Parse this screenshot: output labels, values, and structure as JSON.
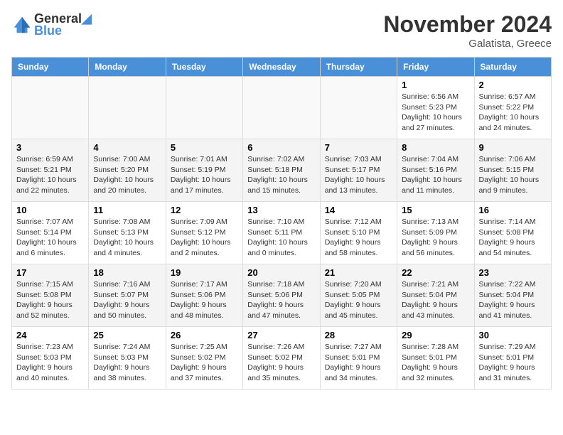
{
  "header": {
    "logo_line1": "General",
    "logo_line2": "Blue",
    "month": "November 2024",
    "location": "Galatista, Greece"
  },
  "weekdays": [
    "Sunday",
    "Monday",
    "Tuesday",
    "Wednesday",
    "Thursday",
    "Friday",
    "Saturday"
  ],
  "weeks": [
    [
      {
        "day": "",
        "info": ""
      },
      {
        "day": "",
        "info": ""
      },
      {
        "day": "",
        "info": ""
      },
      {
        "day": "",
        "info": ""
      },
      {
        "day": "",
        "info": ""
      },
      {
        "day": "1",
        "info": "Sunrise: 6:56 AM\nSunset: 5:23 PM\nDaylight: 10 hours\nand 27 minutes."
      },
      {
        "day": "2",
        "info": "Sunrise: 6:57 AM\nSunset: 5:22 PM\nDaylight: 10 hours\nand 24 minutes."
      }
    ],
    [
      {
        "day": "3",
        "info": "Sunrise: 6:59 AM\nSunset: 5:21 PM\nDaylight: 10 hours\nand 22 minutes."
      },
      {
        "day": "4",
        "info": "Sunrise: 7:00 AM\nSunset: 5:20 PM\nDaylight: 10 hours\nand 20 minutes."
      },
      {
        "day": "5",
        "info": "Sunrise: 7:01 AM\nSunset: 5:19 PM\nDaylight: 10 hours\nand 17 minutes."
      },
      {
        "day": "6",
        "info": "Sunrise: 7:02 AM\nSunset: 5:18 PM\nDaylight: 10 hours\nand 15 minutes."
      },
      {
        "day": "7",
        "info": "Sunrise: 7:03 AM\nSunset: 5:17 PM\nDaylight: 10 hours\nand 13 minutes."
      },
      {
        "day": "8",
        "info": "Sunrise: 7:04 AM\nSunset: 5:16 PM\nDaylight: 10 hours\nand 11 minutes."
      },
      {
        "day": "9",
        "info": "Sunrise: 7:06 AM\nSunset: 5:15 PM\nDaylight: 10 hours\nand 9 minutes."
      }
    ],
    [
      {
        "day": "10",
        "info": "Sunrise: 7:07 AM\nSunset: 5:14 PM\nDaylight: 10 hours\nand 6 minutes."
      },
      {
        "day": "11",
        "info": "Sunrise: 7:08 AM\nSunset: 5:13 PM\nDaylight: 10 hours\nand 4 minutes."
      },
      {
        "day": "12",
        "info": "Sunrise: 7:09 AM\nSunset: 5:12 PM\nDaylight: 10 hours\nand 2 minutes."
      },
      {
        "day": "13",
        "info": "Sunrise: 7:10 AM\nSunset: 5:11 PM\nDaylight: 10 hours\nand 0 minutes."
      },
      {
        "day": "14",
        "info": "Sunrise: 7:12 AM\nSunset: 5:10 PM\nDaylight: 9 hours\nand 58 minutes."
      },
      {
        "day": "15",
        "info": "Sunrise: 7:13 AM\nSunset: 5:09 PM\nDaylight: 9 hours\nand 56 minutes."
      },
      {
        "day": "16",
        "info": "Sunrise: 7:14 AM\nSunset: 5:08 PM\nDaylight: 9 hours\nand 54 minutes."
      }
    ],
    [
      {
        "day": "17",
        "info": "Sunrise: 7:15 AM\nSunset: 5:08 PM\nDaylight: 9 hours\nand 52 minutes."
      },
      {
        "day": "18",
        "info": "Sunrise: 7:16 AM\nSunset: 5:07 PM\nDaylight: 9 hours\nand 50 minutes."
      },
      {
        "day": "19",
        "info": "Sunrise: 7:17 AM\nSunset: 5:06 PM\nDaylight: 9 hours\nand 48 minutes."
      },
      {
        "day": "20",
        "info": "Sunrise: 7:18 AM\nSunset: 5:06 PM\nDaylight: 9 hours\nand 47 minutes."
      },
      {
        "day": "21",
        "info": "Sunrise: 7:20 AM\nSunset: 5:05 PM\nDaylight: 9 hours\nand 45 minutes."
      },
      {
        "day": "22",
        "info": "Sunrise: 7:21 AM\nSunset: 5:04 PM\nDaylight: 9 hours\nand 43 minutes."
      },
      {
        "day": "23",
        "info": "Sunrise: 7:22 AM\nSunset: 5:04 PM\nDaylight: 9 hours\nand 41 minutes."
      }
    ],
    [
      {
        "day": "24",
        "info": "Sunrise: 7:23 AM\nSunset: 5:03 PM\nDaylight: 9 hours\nand 40 minutes."
      },
      {
        "day": "25",
        "info": "Sunrise: 7:24 AM\nSunset: 5:03 PM\nDaylight: 9 hours\nand 38 minutes."
      },
      {
        "day": "26",
        "info": "Sunrise: 7:25 AM\nSunset: 5:02 PM\nDaylight: 9 hours\nand 37 minutes."
      },
      {
        "day": "27",
        "info": "Sunrise: 7:26 AM\nSunset: 5:02 PM\nDaylight: 9 hours\nand 35 minutes."
      },
      {
        "day": "28",
        "info": "Sunrise: 7:27 AM\nSunset: 5:01 PM\nDaylight: 9 hours\nand 34 minutes."
      },
      {
        "day": "29",
        "info": "Sunrise: 7:28 AM\nSunset: 5:01 PM\nDaylight: 9 hours\nand 32 minutes."
      },
      {
        "day": "30",
        "info": "Sunrise: 7:29 AM\nSunset: 5:01 PM\nDaylight: 9 hours\nand 31 minutes."
      }
    ]
  ]
}
